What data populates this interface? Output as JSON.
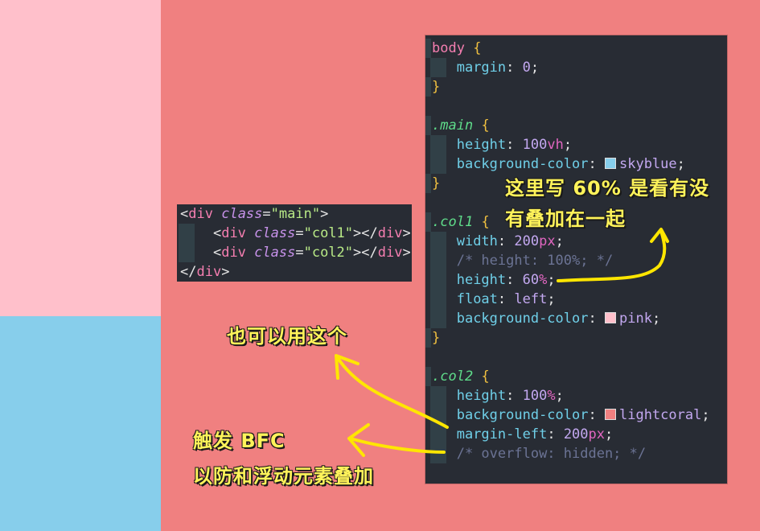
{
  "html_code": {
    "open_tag": "div",
    "class_attr": "class",
    "eq": "=",
    "main_class": "\"main\"",
    "col1_class": "\"col1\"",
    "col2_class": "\"col2\"",
    "lt": "<",
    "gt": ">",
    "close_open": "</",
    "close_tag": "div"
  },
  "css_code": {
    "body_selector": "body",
    "margin_prop": "margin",
    "margin_val": "0",
    "main_selector": ".main",
    "main_height_prop": "height",
    "main_height_num": "100",
    "main_height_unit": "vh",
    "main_bg_prop": "background-color",
    "main_bg_val": "skyblue",
    "col1_selector": ".col1",
    "col1_width_prop": "width",
    "col1_width_num": "200",
    "col1_width_unit": "px",
    "col1_comment": "/* height: 100%; */",
    "col1_height_prop": "height",
    "col1_height_num": "60",
    "col1_height_unit": "%",
    "col1_float_prop": "float",
    "col1_float_val": "left",
    "col1_bg_prop": "background-color",
    "col1_bg_val": "pink",
    "col2_selector": ".col2",
    "col2_height_prop": "height",
    "col2_height_num": "100",
    "col2_height_unit": "%",
    "col2_bg_prop": "background-color",
    "col2_bg_val": "lightcoral",
    "col2_margin_prop": "margin-left",
    "col2_margin_num": "200",
    "col2_margin_unit": "px",
    "col2_comment": "/* overflow: hidden; */",
    "open_brace": "{",
    "close_brace": "}",
    "colon": ":",
    "semicolon": ";"
  },
  "annotations": {
    "note_60_line1": "这里写 60% 是看有没",
    "note_60_line2": "有叠加在一起",
    "note_also": "也可以用这个",
    "note_bfc_line1": "触发 BFC",
    "note_bfc_line2": "以防和浮动元素叠加"
  },
  "colors": {
    "skyblue": "#87ceeb",
    "pink": "#ffc0cb",
    "lightcoral": "#f08080",
    "editor_bg": "#282c34",
    "annotation": "#fff35a"
  }
}
